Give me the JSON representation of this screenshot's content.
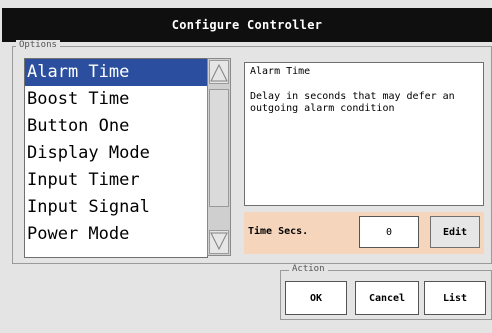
{
  "window": {
    "title": "Configure Controller"
  },
  "options": {
    "legend": "Options",
    "items": [
      {
        "label": "Alarm Time"
      },
      {
        "label": "Boost Time"
      },
      {
        "label": "Button One"
      },
      {
        "label": "Display Mode"
      },
      {
        "label": "Input Timer"
      },
      {
        "label": "Input Signal"
      },
      {
        "label": "Power Mode"
      }
    ],
    "selected": "Alarm Time"
  },
  "description": {
    "title": "Alarm Time",
    "text": "Delay in seconds that may defer an outgoing alarm condition"
  },
  "parameter": {
    "label": "Time Secs.",
    "value": "0",
    "edit_label": "Edit"
  },
  "action": {
    "legend": "Action",
    "ok_label": "OK",
    "cancel_label": "Cancel",
    "list_label": "List"
  },
  "colors": {
    "titlebar": "#0f0f0f",
    "selection": "#2b4e9e",
    "parameter_row": "#f5d6bd"
  }
}
